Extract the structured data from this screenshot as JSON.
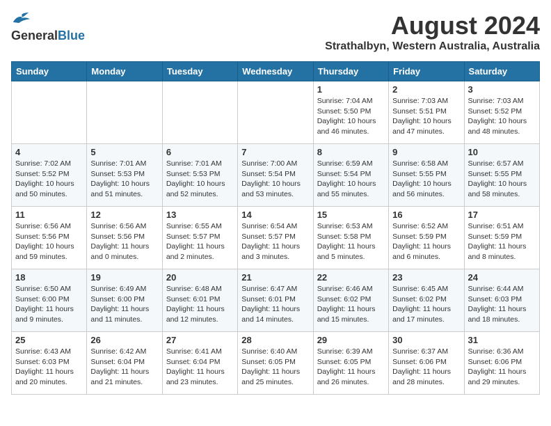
{
  "header": {
    "logo_general": "General",
    "logo_blue": "Blue",
    "month_title": "August 2024",
    "location": "Strathalbyn, Western Australia, Australia"
  },
  "days_of_week": [
    "Sunday",
    "Monday",
    "Tuesday",
    "Wednesday",
    "Thursday",
    "Friday",
    "Saturday"
  ],
  "weeks": [
    [
      {
        "day": "",
        "content": ""
      },
      {
        "day": "",
        "content": ""
      },
      {
        "day": "",
        "content": ""
      },
      {
        "day": "",
        "content": ""
      },
      {
        "day": "1",
        "content": "Sunrise: 7:04 AM\nSunset: 5:50 PM\nDaylight: 10 hours\nand 46 minutes."
      },
      {
        "day": "2",
        "content": "Sunrise: 7:03 AM\nSunset: 5:51 PM\nDaylight: 10 hours\nand 47 minutes."
      },
      {
        "day": "3",
        "content": "Sunrise: 7:03 AM\nSunset: 5:52 PM\nDaylight: 10 hours\nand 48 minutes."
      }
    ],
    [
      {
        "day": "4",
        "content": "Sunrise: 7:02 AM\nSunset: 5:52 PM\nDaylight: 10 hours\nand 50 minutes."
      },
      {
        "day": "5",
        "content": "Sunrise: 7:01 AM\nSunset: 5:53 PM\nDaylight: 10 hours\nand 51 minutes."
      },
      {
        "day": "6",
        "content": "Sunrise: 7:01 AM\nSunset: 5:53 PM\nDaylight: 10 hours\nand 52 minutes."
      },
      {
        "day": "7",
        "content": "Sunrise: 7:00 AM\nSunset: 5:54 PM\nDaylight: 10 hours\nand 53 minutes."
      },
      {
        "day": "8",
        "content": "Sunrise: 6:59 AM\nSunset: 5:54 PM\nDaylight: 10 hours\nand 55 minutes."
      },
      {
        "day": "9",
        "content": "Sunrise: 6:58 AM\nSunset: 5:55 PM\nDaylight: 10 hours\nand 56 minutes."
      },
      {
        "day": "10",
        "content": "Sunrise: 6:57 AM\nSunset: 5:55 PM\nDaylight: 10 hours\nand 58 minutes."
      }
    ],
    [
      {
        "day": "11",
        "content": "Sunrise: 6:56 AM\nSunset: 5:56 PM\nDaylight: 10 hours\nand 59 minutes."
      },
      {
        "day": "12",
        "content": "Sunrise: 6:56 AM\nSunset: 5:56 PM\nDaylight: 11 hours\nand 0 minutes."
      },
      {
        "day": "13",
        "content": "Sunrise: 6:55 AM\nSunset: 5:57 PM\nDaylight: 11 hours\nand 2 minutes."
      },
      {
        "day": "14",
        "content": "Sunrise: 6:54 AM\nSunset: 5:57 PM\nDaylight: 11 hours\nand 3 minutes."
      },
      {
        "day": "15",
        "content": "Sunrise: 6:53 AM\nSunset: 5:58 PM\nDaylight: 11 hours\nand 5 minutes."
      },
      {
        "day": "16",
        "content": "Sunrise: 6:52 AM\nSunset: 5:59 PM\nDaylight: 11 hours\nand 6 minutes."
      },
      {
        "day": "17",
        "content": "Sunrise: 6:51 AM\nSunset: 5:59 PM\nDaylight: 11 hours\nand 8 minutes."
      }
    ],
    [
      {
        "day": "18",
        "content": "Sunrise: 6:50 AM\nSunset: 6:00 PM\nDaylight: 11 hours\nand 9 minutes."
      },
      {
        "day": "19",
        "content": "Sunrise: 6:49 AM\nSunset: 6:00 PM\nDaylight: 11 hours\nand 11 minutes."
      },
      {
        "day": "20",
        "content": "Sunrise: 6:48 AM\nSunset: 6:01 PM\nDaylight: 11 hours\nand 12 minutes."
      },
      {
        "day": "21",
        "content": "Sunrise: 6:47 AM\nSunset: 6:01 PM\nDaylight: 11 hours\nand 14 minutes."
      },
      {
        "day": "22",
        "content": "Sunrise: 6:46 AM\nSunset: 6:02 PM\nDaylight: 11 hours\nand 15 minutes."
      },
      {
        "day": "23",
        "content": "Sunrise: 6:45 AM\nSunset: 6:02 PM\nDaylight: 11 hours\nand 17 minutes."
      },
      {
        "day": "24",
        "content": "Sunrise: 6:44 AM\nSunset: 6:03 PM\nDaylight: 11 hours\nand 18 minutes."
      }
    ],
    [
      {
        "day": "25",
        "content": "Sunrise: 6:43 AM\nSunset: 6:03 PM\nDaylight: 11 hours\nand 20 minutes."
      },
      {
        "day": "26",
        "content": "Sunrise: 6:42 AM\nSunset: 6:04 PM\nDaylight: 11 hours\nand 21 minutes."
      },
      {
        "day": "27",
        "content": "Sunrise: 6:41 AM\nSunset: 6:04 PM\nDaylight: 11 hours\nand 23 minutes."
      },
      {
        "day": "28",
        "content": "Sunrise: 6:40 AM\nSunset: 6:05 PM\nDaylight: 11 hours\nand 25 minutes."
      },
      {
        "day": "29",
        "content": "Sunrise: 6:39 AM\nSunset: 6:05 PM\nDaylight: 11 hours\nand 26 minutes."
      },
      {
        "day": "30",
        "content": "Sunrise: 6:37 AM\nSunset: 6:06 PM\nDaylight: 11 hours\nand 28 minutes."
      },
      {
        "day": "31",
        "content": "Sunrise: 6:36 AM\nSunset: 6:06 PM\nDaylight: 11 hours\nand 29 minutes."
      }
    ]
  ]
}
